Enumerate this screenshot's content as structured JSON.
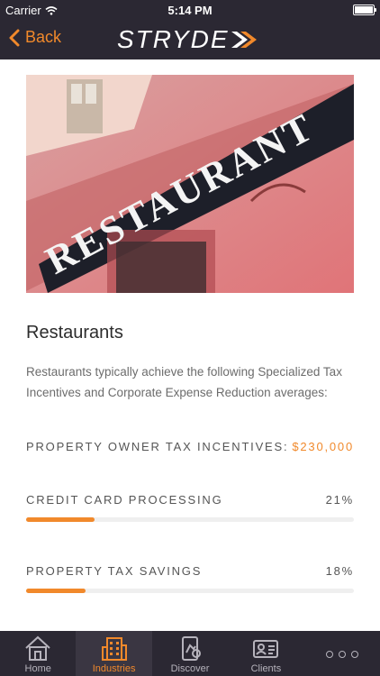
{
  "status_bar": {
    "carrier": "Carrier",
    "time": "5:14 PM"
  },
  "nav": {
    "back_label": "Back",
    "logo_text": "STRYDE"
  },
  "hero": {
    "sign_text": "RESTAURANT"
  },
  "content": {
    "title": "Restaurants",
    "description": "Restaurants typically achieve the following Specialized Tax Incentives and Corporate Expense Reduction averages:"
  },
  "stats": [
    {
      "label": "PROPERTY OWNER TAX INCENTIVES:",
      "value": "$230,000"
    },
    {
      "label": "CREDIT CARD PROCESSING",
      "value": "21%",
      "progress": 0.21
    },
    {
      "label": "PROPERTY TAX SAVINGS",
      "value": "18%",
      "progress": 0.18
    }
  ],
  "tabs": [
    {
      "label": "Home",
      "icon": "home-icon"
    },
    {
      "label": "Industries",
      "icon": "building-icon",
      "active": true
    },
    {
      "label": "Discover",
      "icon": "discover-icon"
    },
    {
      "label": "Clients",
      "icon": "id-card-icon"
    },
    {
      "label": "",
      "icon": "more-icon"
    }
  ],
  "colors": {
    "accent": "#f1892b",
    "bar": "#2b2833",
    "text": "#2c2c2c",
    "muted": "#6c6c6c"
  }
}
